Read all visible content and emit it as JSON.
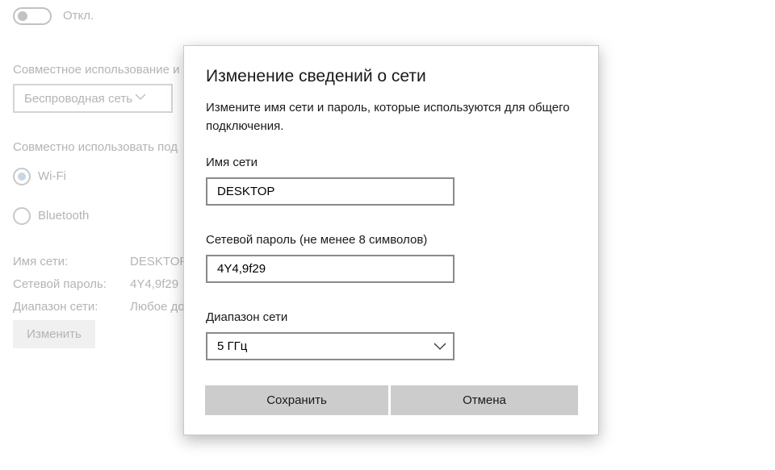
{
  "background": {
    "toggle_label": "Откл.",
    "share_from_label": "Совместное использование и",
    "share_from_select": "Беспроводная сеть",
    "share_over_label": "Совместно использовать под",
    "radio_wifi": "Wi-Fi",
    "radio_bluetooth": "Bluetooth",
    "info": {
      "network_name_label": "Имя сети:",
      "network_name_value": "DESKTOP",
      "password_label": "Сетевой пароль:",
      "password_value": "4Y4,9f29",
      "band_label": "Диапазон сети:",
      "band_value": "Любое до"
    },
    "edit_button": "Изменить"
  },
  "dialog": {
    "title": "Изменение сведений о сети",
    "description": "Измените имя сети и пароль, которые используются для общего подключения.",
    "network_name_label": "Имя сети",
    "network_name_value": "DESKTOP",
    "password_label": "Сетевой пароль (не менее 8 символов)",
    "password_value": "4Y4,9f29",
    "band_label": "Диапазон сети",
    "band_value": "5 ГГц",
    "save_button": "Сохранить",
    "cancel_button": "Отмена"
  },
  "colors": {
    "dimmed_text": "#b4b4b4",
    "button_bg": "#cccccc",
    "field_border": "#8a8a8a"
  }
}
